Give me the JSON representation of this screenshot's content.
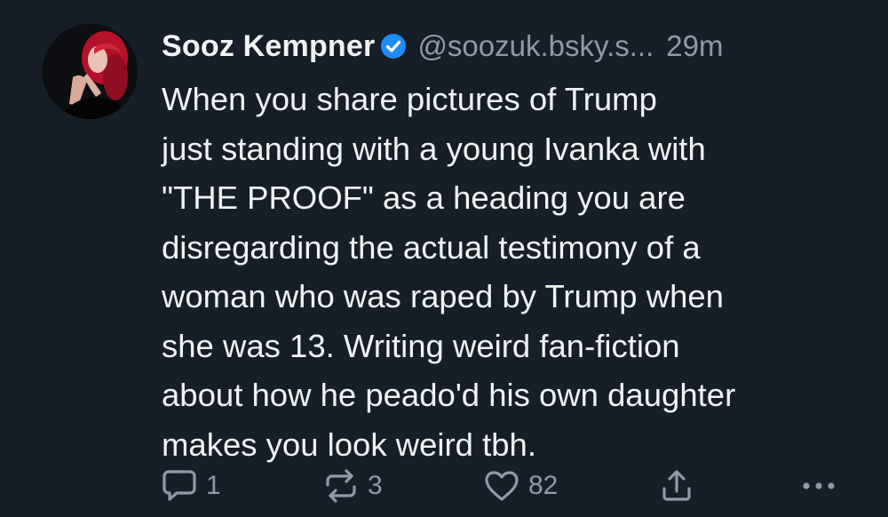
{
  "post": {
    "author": {
      "display_name": "Sooz Kempner",
      "handle": "@soozuk.bsky.s...",
      "verified": true,
      "verified_icon": "verified-check-icon"
    },
    "timestamp": "29m",
    "text_lines": [
      "When you share pictures of Trump",
      "just standing with a young Ivanka with",
      "\"THE PROOF\" as a heading you are",
      "disregarding the actual testimony of a",
      "woman who was raped by Trump when",
      "she was 13. Writing weird fan-fiction",
      "about how he peado'd his own daughter",
      "makes you look weird tbh."
    ],
    "actions": {
      "reply": {
        "icon": "reply-icon",
        "count": "1"
      },
      "repost": {
        "icon": "repost-icon",
        "count": "3"
      },
      "like": {
        "icon": "heart-icon",
        "count": "82"
      },
      "share": {
        "icon": "share-icon"
      },
      "more": {
        "icon": "more-icon"
      }
    }
  },
  "colors": {
    "background": "#161e27",
    "text": "#f1f3f5",
    "muted": "#8d9bab",
    "verified": "#1d8cf8"
  }
}
